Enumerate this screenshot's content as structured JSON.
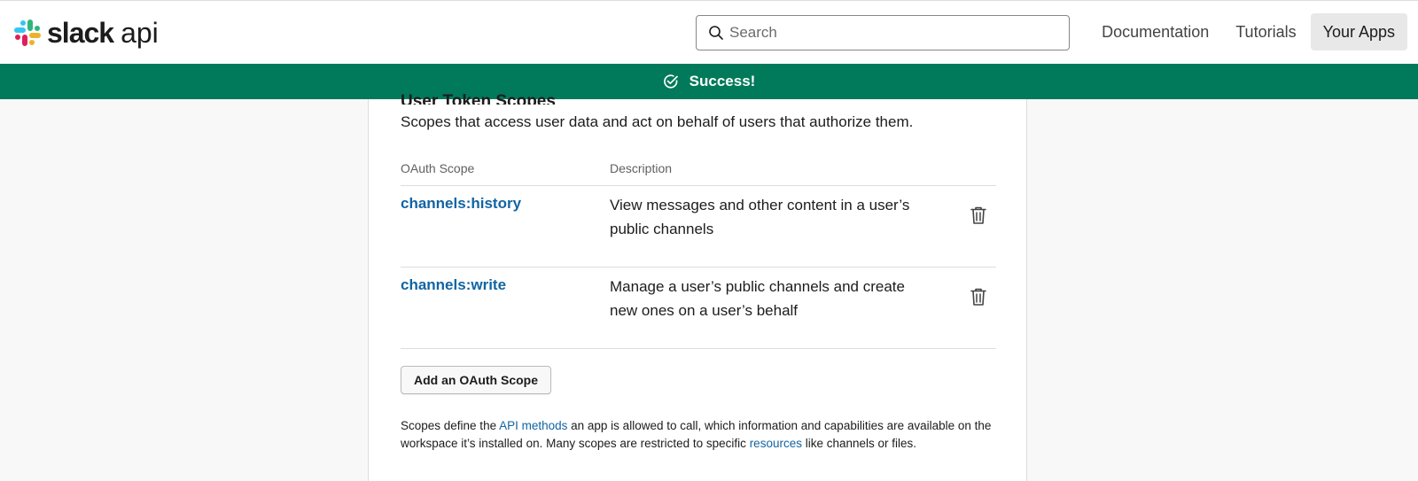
{
  "header": {
    "logo_word": "slack",
    "logo_api": "api",
    "search_placeholder": "Search",
    "nav": [
      {
        "label": "Documentation"
      },
      {
        "label": "Tutorials"
      },
      {
        "label": "Your Apps"
      }
    ]
  },
  "banner": {
    "text": "Success!",
    "color": "#007a5a"
  },
  "section": {
    "title": "User Token Scopes",
    "description": "Scopes that access user data and act on behalf of users that authorize them.",
    "columns": {
      "scope": "OAuth Scope",
      "description": "Description"
    },
    "scopes": [
      {
        "name": "channels:history",
        "description": "View messages and other content in a user’s public channels"
      },
      {
        "name": "channels:write",
        "description": "Manage a user’s public channels and create new ones on a user’s behalf"
      }
    ],
    "add_button": "Add an OAuth Scope",
    "footnote": {
      "part1": "Scopes define the ",
      "link1": "API methods",
      "part2": " an app is allowed to call, which information and capabilities are available on the workspace it’s installed on. Many scopes are restricted to specific ",
      "link2": "resources",
      "part3": " like channels or files."
    }
  },
  "colors": {
    "link": "#1264a3",
    "accent_green": "#007a5a"
  }
}
